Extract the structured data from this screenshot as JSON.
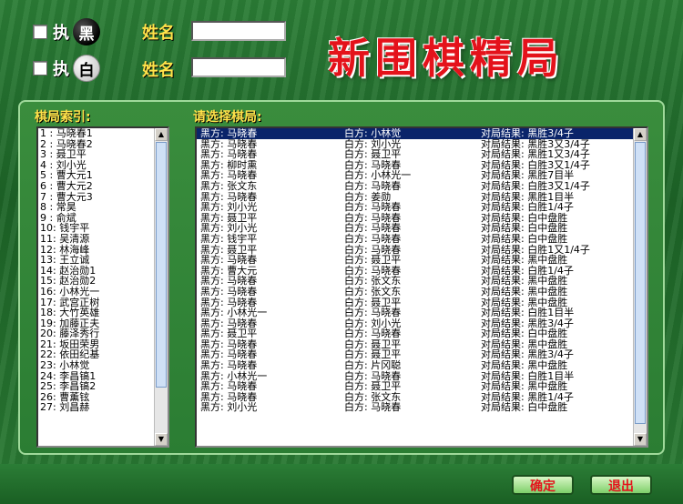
{
  "players": {
    "black": {
      "hold_label": "执",
      "stone_label": "黑",
      "name_label": "姓名",
      "name_value": ""
    },
    "white": {
      "hold_label": "执",
      "stone_label": "白",
      "name_label": "姓名",
      "name_value": ""
    }
  },
  "app_title": "新围棋精局",
  "index": {
    "label": "棋局索引:",
    "items": [
      "1 : 马晓春1",
      "2 : 马晓春2",
      "3 : 聂卫平",
      "4 : 刘小光",
      "5 : 曹大元1",
      "6 : 曹大元2",
      "7 : 曹大元3",
      "8 : 常昊",
      "9 : 俞斌",
      "10: 钱宇平",
      "11: 吴清源",
      "12: 林海峰",
      "13: 王立诚",
      "14: 赵治勋1",
      "15: 赵治勋2",
      "16: 小林光一",
      "17: 武宫正树",
      "18: 大竹英雄",
      "19: 加藤正夫",
      "20: 藤泽秀行",
      "21: 坂田荣男",
      "22: 依田纪基",
      "23: 小林觉",
      "24: 李昌镐1",
      "25: 李昌镐2",
      "26: 曹薰铉",
      "27: 刘昌赫"
    ]
  },
  "games": {
    "label": "请选择棋局:",
    "rows": [
      {
        "black": "黑方: 马晓春",
        "white": "白方: 小林觉",
        "result": "对局结果: 黑胜3/4子"
      },
      {
        "black": "黑方: 马晓春",
        "white": "白方: 刘小光",
        "result": "对局结果: 黑胜3又3/4子"
      },
      {
        "black": "黑方: 马晓春",
        "white": "白方: 聂卫平",
        "result": "对局结果: 黑胜1又3/4子"
      },
      {
        "black": "黑方: 柳时熏",
        "white": "白方: 马晓春",
        "result": "对局结果: 白胜3又1/4子"
      },
      {
        "black": "黑方: 马晓春",
        "white": "白方: 小林光一",
        "result": "对局结果: 黑胜7目半"
      },
      {
        "black": "黑方: 张文东",
        "white": "白方: 马晓春",
        "result": "对局结果: 白胜3又1/4子"
      },
      {
        "black": "黑方: 马晓春",
        "white": "白方: 姜勋",
        "result": "对局结果: 黑胜1目半"
      },
      {
        "black": "黑方: 刘小光",
        "white": "白方: 马晓春",
        "result": "对局结果: 白胜1/4子"
      },
      {
        "black": "黑方: 聂卫平",
        "white": "白方: 马晓春",
        "result": "对局结果: 白中盘胜"
      },
      {
        "black": "黑方: 刘小光",
        "white": "白方: 马晓春",
        "result": "对局结果: 白中盘胜"
      },
      {
        "black": "黑方: 钱宇平",
        "white": "白方: 马晓春",
        "result": "对局结果: 白中盘胜"
      },
      {
        "black": "黑方: 聂卫平",
        "white": "白方: 马晓春",
        "result": "对局结果: 白胜1又1/4子"
      },
      {
        "black": "黑方: 马晓春",
        "white": "白方: 聂卫平",
        "result": "对局结果: 黑中盘胜"
      },
      {
        "black": "黑方: 曹大元",
        "white": "白方: 马晓春",
        "result": "对局结果: 白胜1/4子"
      },
      {
        "black": "黑方: 马晓春",
        "white": "白方: 张文东",
        "result": "对局结果: 黑中盘胜"
      },
      {
        "black": "黑方: 马晓春",
        "white": "白方: 张文东",
        "result": "对局结果: 黑中盘胜"
      },
      {
        "black": "黑方: 马晓春",
        "white": "白方: 聂卫平",
        "result": "对局结果: 黑中盘胜"
      },
      {
        "black": "黑方: 小林光一",
        "white": "白方: 马晓春",
        "result": "对局结果: 白胜1目半"
      },
      {
        "black": "黑方: 马晓春",
        "white": "白方: 刘小光",
        "result": "对局结果: 黑胜3/4子"
      },
      {
        "black": "黑方: 聂卫平",
        "white": "白方: 马晓春",
        "result": "对局结果: 白中盘胜"
      },
      {
        "black": "黑方: 马晓春",
        "white": "白方: 聂卫平",
        "result": "对局结果: 黑中盘胜"
      },
      {
        "black": "黑方: 马晓春",
        "white": "白方: 聂卫平",
        "result": "对局结果: 黑胜3/4子"
      },
      {
        "black": "黑方: 马晓春",
        "white": "白方: 片冈聪",
        "result": "对局结果: 黑中盘胜"
      },
      {
        "black": "黑方: 小林光一",
        "white": "白方: 马晓春",
        "result": "对局结果: 白胜1目半"
      },
      {
        "black": "黑方: 马晓春",
        "white": "白方: 聂卫平",
        "result": "对局结果: 黑中盘胜"
      },
      {
        "black": "黑方: 马晓春",
        "white": "白方: 张文东",
        "result": "对局结果: 黑胜1/4子"
      },
      {
        "black": "黑方: 刘小光",
        "white": "白方: 马晓春",
        "result": "对局结果: 白中盘胜"
      }
    ]
  },
  "buttons": {
    "ok": "确定",
    "exit": "退出"
  },
  "colors": {
    "accent_yellow": "#ffe24a",
    "title_red": "#e4121b",
    "selection": "#0a246a"
  }
}
